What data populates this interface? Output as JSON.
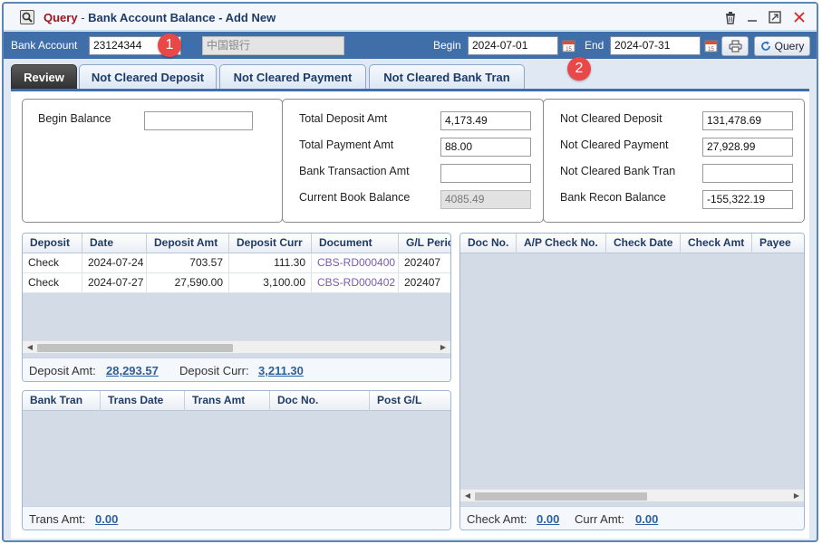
{
  "window": {
    "title_query": "Query",
    "title_separator": " - ",
    "title_main": "Bank Account Balance - Add New",
    "icons": [
      "search-icon",
      "trash-icon",
      "minimize-icon",
      "maximize-icon",
      "close-icon"
    ]
  },
  "toolbar": {
    "bank_account_label": "Bank Account",
    "bank_account_value": "23124344",
    "bank_name": "中国银行",
    "begin_label": "Begin",
    "begin_date": "2024-07-01",
    "end_label": "End",
    "end_date": "2024-07-31",
    "query_label": "Query"
  },
  "badges": [
    "1",
    "2"
  ],
  "tabs": [
    {
      "label": "Review",
      "active": true
    },
    {
      "label": "Not Cleared Deposit",
      "active": false
    },
    {
      "label": "Not Cleared Payment",
      "active": false
    },
    {
      "label": "Not Cleared Bank Tran",
      "active": false
    }
  ],
  "summary": {
    "begin_balance_label": "Begin Balance",
    "begin_balance_value": "",
    "total_deposit_label": "Total Deposit Amt",
    "total_deposit_value": "4,173.49",
    "total_payment_label": "Total Payment Amt",
    "total_payment_value": "88.00",
    "bank_tran_label": "Bank Transaction Amt",
    "bank_tran_value": "",
    "book_balance_label": "Current Book Balance",
    "book_balance_value": "4085.49",
    "nc_deposit_label": "Not Cleared Deposit",
    "nc_deposit_value": "131,478.69",
    "nc_payment_label": "Not Cleared Payment",
    "nc_payment_value": "27,928.99",
    "nc_bank_tran_label": "Not Cleared Bank Tran",
    "nc_bank_tran_value": "",
    "recon_balance_label": "Bank Recon Balance",
    "recon_balance_value": "-155,322.19"
  },
  "deposit_grid": {
    "columns": [
      "Deposit",
      "Date",
      "Deposit Amt",
      "Deposit Curr",
      "Document",
      "G/L Period"
    ],
    "rows": [
      [
        "Check",
        "2024-07-24",
        "703.57",
        "111.30",
        "CBS-RD000400",
        "202407"
      ],
      [
        "Check",
        "2024-07-27",
        "27,590.00",
        "3,100.00",
        "CBS-RD000402",
        "202407"
      ]
    ],
    "footer_amt_label": "Deposit Amt:",
    "footer_amt_value": "28,293.57",
    "footer_curr_label": "Deposit Curr:",
    "footer_curr_value": "3,211.30"
  },
  "bank_tran_grid": {
    "columns": [
      "Bank Tran",
      "Trans Date",
      "Trans Amt",
      "Doc No.",
      "Post G/L"
    ],
    "footer_label": "Trans Amt:",
    "footer_value": "0.00"
  },
  "check_grid": {
    "columns": [
      "Doc No.",
      "A/P Check No.",
      "Check Date",
      "Check Amt",
      "Payee"
    ],
    "footer_amt_label": "Check Amt:",
    "footer_amt_value": "0.00",
    "footer_curr_label": "Curr Amt:",
    "footer_curr_value": "0.00"
  }
}
